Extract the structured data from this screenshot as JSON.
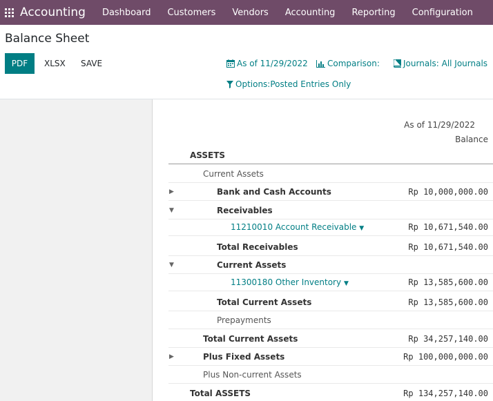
{
  "navbar": {
    "app_name": "Accounting",
    "menu": [
      "Dashboard",
      "Customers",
      "Vendors",
      "Accounting",
      "Reporting",
      "Configuration"
    ]
  },
  "control_panel": {
    "title": "Balance Sheet",
    "buttons": {
      "pdf": "PDF",
      "xlsx": "XLSX",
      "save": "SAVE"
    },
    "filters": {
      "date": "As of 11/29/2022",
      "comparison": "Comparison:",
      "journals": "Journals: All Journals",
      "options": "Options:Posted Entries Only"
    }
  },
  "report": {
    "column_date": "As of 11/29/2022",
    "column_balance": "Balance",
    "rows": [
      {
        "label": "ASSETS",
        "amount": ""
      },
      {
        "label": "Current Assets",
        "amount": ""
      },
      {
        "label": "Bank and Cash Accounts",
        "amount": "Rp 10,000,000.00"
      },
      {
        "label": "Receivables",
        "amount": ""
      },
      {
        "label": "11210010 Account Receivable",
        "amount": "Rp 10,671,540.00"
      },
      {
        "label": "Total Receivables",
        "amount": "Rp 10,671,540.00"
      },
      {
        "label": "Current Assets",
        "amount": ""
      },
      {
        "label": "11300180 Other Inventory",
        "amount": "Rp 13,585,600.00"
      },
      {
        "label": "Total Current Assets",
        "amount": "Rp 13,585,600.00"
      },
      {
        "label": "Prepayments",
        "amount": ""
      },
      {
        "label": "Total Current Assets",
        "amount": "Rp 34,257,140.00"
      },
      {
        "label": "Plus Fixed Assets",
        "amount": "Rp 100,000,000.00"
      },
      {
        "label": "Plus Non-current Assets",
        "amount": ""
      },
      {
        "label": "Total ASSETS",
        "amount": "Rp 134,257,140.00"
      }
    ]
  },
  "colors": {
    "navbar": "#6f4b68",
    "primary": "#017e84"
  }
}
